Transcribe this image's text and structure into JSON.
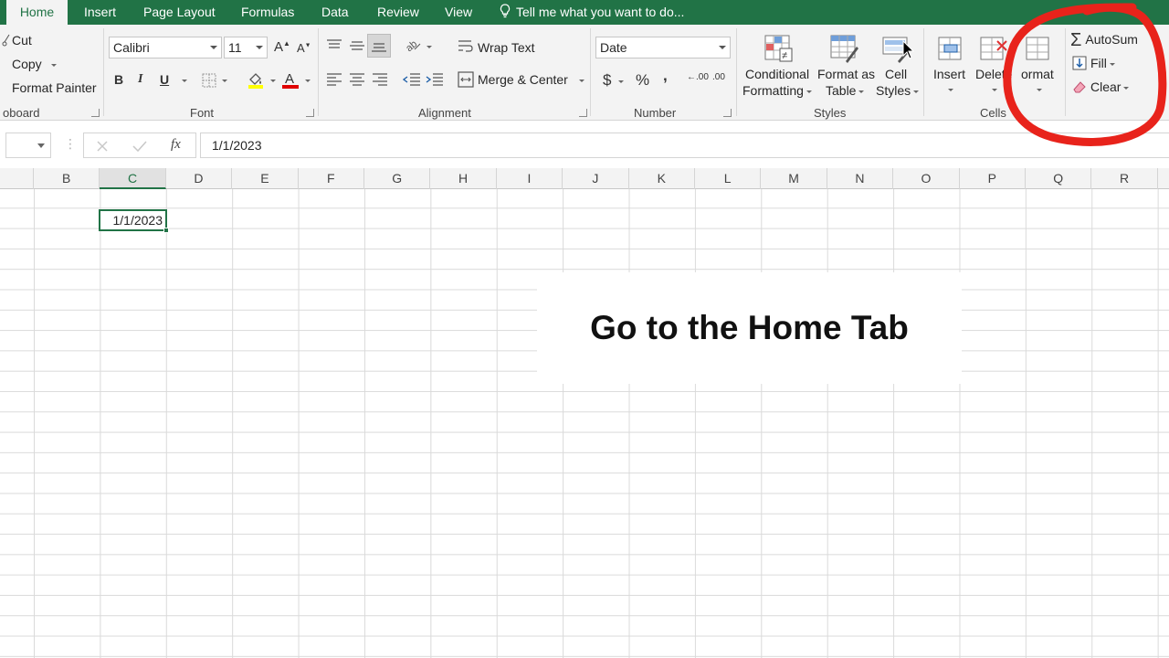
{
  "tabs": {
    "home": "Home",
    "insert": "Insert",
    "page_layout": "Page Layout",
    "formulas": "Formulas",
    "data": "Data",
    "review": "Review",
    "view": "View",
    "tell_me": "Tell me what you want to do..."
  },
  "clipboard": {
    "cut": "Cut",
    "copy": "Copy",
    "format_painter": "Format Painter",
    "label": "oboard"
  },
  "font": {
    "name": "Calibri",
    "size": "11",
    "grow": "A",
    "shrink": "A",
    "bold": "B",
    "italic": "I",
    "underline": "U",
    "label": "Font"
  },
  "alignment": {
    "wrap_text": "Wrap Text",
    "merge_center": "Merge & Center",
    "label": "Alignment"
  },
  "number": {
    "format": "Date",
    "currency": "$",
    "percent": "%",
    "comma": ",",
    "inc_decimal": ".00",
    "dec_decimal": ".00",
    "label": "Number"
  },
  "styles": {
    "conditional_1": "Conditional",
    "conditional_2": "Formatting",
    "format_table_1": "Format as",
    "format_table_2": "Table",
    "cell_styles_1": "Cell",
    "cell_styles_2": "Styles",
    "label": "Styles"
  },
  "cells": {
    "insert": "Insert",
    "delete": "Delete",
    "format": "ormat",
    "label": "Cells"
  },
  "editing": {
    "autosum": "AutoSum",
    "fill": "Fill",
    "clear": "Clear"
  },
  "formula_bar": {
    "value": "1/1/2023",
    "fx": "fx"
  },
  "columns": [
    "B",
    "C",
    "D",
    "E",
    "F",
    "G",
    "H",
    "I",
    "J",
    "K",
    "L",
    "M",
    "N",
    "O",
    "P",
    "Q",
    "R"
  ],
  "active_cell": {
    "value": "1/1/2023"
  },
  "caption": "Go to the Home Tab",
  "colors": {
    "excel_green": "#217346",
    "ribbon_bg": "#f3f3f3",
    "annotation_red": "#e8231b"
  }
}
